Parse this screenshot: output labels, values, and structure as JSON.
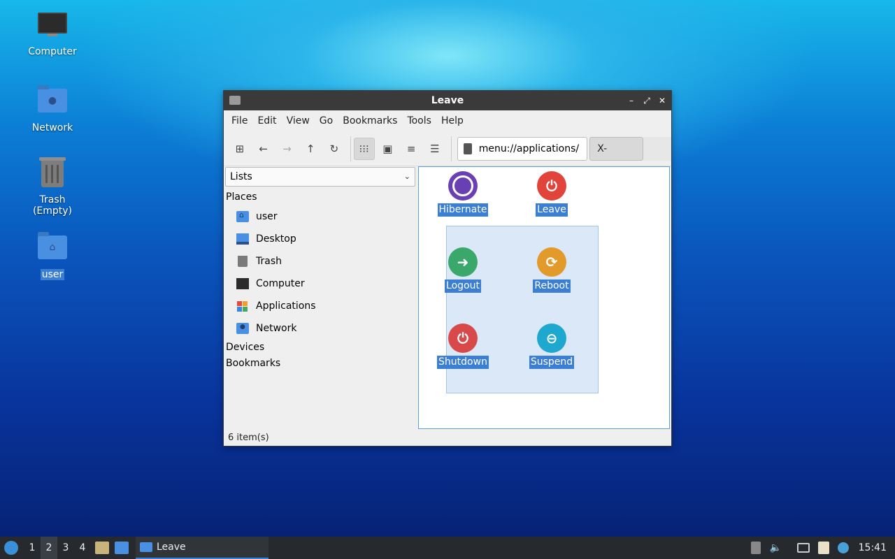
{
  "desktop": {
    "icons": [
      {
        "label": "Computer",
        "icon": "computer-icon"
      },
      {
        "label": "Network",
        "icon": "network-folder-icon"
      },
      {
        "label": "Trash (Empty)",
        "icon": "trash-icon"
      },
      {
        "label": "user",
        "icon": "home-folder-icon"
      }
    ]
  },
  "window": {
    "title": "Leave",
    "menu": [
      "File",
      "Edit",
      "View",
      "Go",
      "Bookmarks",
      "Tools",
      "Help"
    ],
    "address": "menu://applications/",
    "crumb": "X-Leave",
    "side_select": "Lists",
    "sections": {
      "places": "Places",
      "devices": "Devices",
      "bookmarks": "Bookmarks"
    },
    "places": [
      "user",
      "Desktop",
      "Trash",
      "Computer",
      "Applications",
      "Network"
    ],
    "items": [
      {
        "label": "Hibernate",
        "color": "#6a3fb3"
      },
      {
        "label": "Leave",
        "color": "#e0443a"
      },
      {
        "label": "Logout",
        "color": "#3aa86a"
      },
      {
        "label": "Reboot",
        "color": "#e29a2a"
      },
      {
        "label": "Shutdown",
        "color": "#d84a4a"
      },
      {
        "label": "Suspend",
        "color": "#1fa8cf"
      }
    ],
    "status": "6 item(s)"
  },
  "taskbar": {
    "workspaces": [
      "1",
      "2",
      "3",
      "4"
    ],
    "task_label": "Leave",
    "clock": "15:41"
  }
}
